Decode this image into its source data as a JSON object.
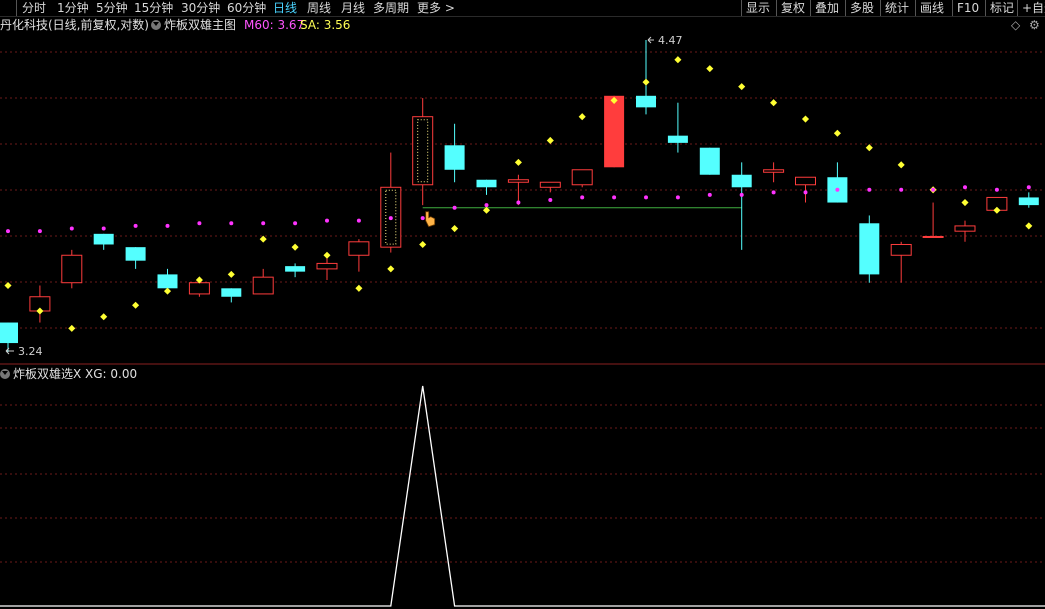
{
  "toolbar": {
    "left_tabs": [
      "分时",
      "1分钟",
      "5分钟",
      "15分钟",
      "30分钟",
      "60分钟",
      "日线",
      "周线",
      "月线",
      "多周期",
      "更多 >"
    ],
    "active_tab": "日线",
    "right_tabs": [
      "显示",
      "复权",
      "叠加",
      "多股",
      "统计",
      "画线",
      "F10",
      "标记",
      "+自选"
    ]
  },
  "main": {
    "stock_title": "丹化科技(日线,前复权,对数)",
    "indicator_name": "炸板双雄主图",
    "m60_label": "M60: 3.67",
    "sa_label": "SA: 3.56",
    "high_marker": "4.47",
    "low_marker": "3.24"
  },
  "sub": {
    "indicator_name": "炸板双雄选X",
    "xg_label": "XG: 0.00"
  },
  "colors": {
    "up": "#ff3d3d",
    "down": "#54ffff",
    "yellow_dots": "#ffff33",
    "magenta_dots": "#ff33ff",
    "grid": "#6b1a1a",
    "m60_text": "#ff55ff",
    "sa_text": "#ffff55",
    "active_tab": "#4ad4ff"
  },
  "chart_data": {
    "type": "candlestick",
    "candles": [
      {
        "o": 3.34,
        "c": 3.27,
        "h": 3.34,
        "l": 3.24
      },
      {
        "o": 3.38,
        "c": 3.43,
        "h": 3.47,
        "l": 3.34
      },
      {
        "o": 3.48,
        "c": 3.58,
        "h": 3.6,
        "l": 3.46
      },
      {
        "o": 3.66,
        "c": 3.62,
        "h": 3.66,
        "l": 3.6
      },
      {
        "o": 3.61,
        "c": 3.56,
        "h": 3.61,
        "l": 3.53
      },
      {
        "o": 3.51,
        "c": 3.46,
        "h": 3.53,
        "l": 3.45
      },
      {
        "o": 3.44,
        "c": 3.48,
        "h": 3.5,
        "l": 3.43
      },
      {
        "o": 3.46,
        "c": 3.43,
        "h": 3.46,
        "l": 3.41
      },
      {
        "o": 3.44,
        "c": 3.5,
        "h": 3.53,
        "l": 3.44
      },
      {
        "o": 3.54,
        "c": 3.52,
        "h": 3.55,
        "l": 3.5
      },
      {
        "o": 3.53,
        "c": 3.55,
        "h": 3.58,
        "l": 3.49
      },
      {
        "o": 3.58,
        "c": 3.63,
        "h": 3.64,
        "l": 3.52
      },
      {
        "o": 3.61,
        "c": 3.84,
        "h": 3.98,
        "l": 3.59
      },
      {
        "o": 3.85,
        "c": 4.13,
        "h": 4.21,
        "l": 3.77
      },
      {
        "o": 4.01,
        "c": 3.91,
        "h": 4.1,
        "l": 3.86
      },
      {
        "o": 3.87,
        "c": 3.84,
        "h": 3.87,
        "l": 3.81
      },
      {
        "o": 3.86,
        "c": 3.87,
        "h": 3.89,
        "l": 3.77
      },
      {
        "o": 3.84,
        "c": 3.86,
        "h": 3.86,
        "l": 3.82
      },
      {
        "o": 3.85,
        "c": 3.91,
        "h": 3.91,
        "l": 3.84
      },
      {
        "o": 3.92,
        "c": 4.22,
        "h": 4.22,
        "l": 3.92
      },
      {
        "o": 4.22,
        "c": 4.17,
        "h": 4.47,
        "l": 4.14
      },
      {
        "o": 4.05,
        "c": 4.02,
        "h": 4.19,
        "l": 3.98
      },
      {
        "o": 4.0,
        "c": 3.89,
        "h": 4.0,
        "l": 3.89
      },
      {
        "o": 3.89,
        "c": 3.84,
        "h": 3.94,
        "l": 3.6
      },
      {
        "o": 3.9,
        "c": 3.91,
        "h": 3.94,
        "l": 3.86
      },
      {
        "o": 3.85,
        "c": 3.88,
        "h": 3.88,
        "l": 3.78
      },
      {
        "o": 3.88,
        "c": 3.78,
        "h": 3.94,
        "l": 3.78
      },
      {
        "o": 3.7,
        "c": 3.51,
        "h": 3.73,
        "l": 3.48
      },
      {
        "o": 3.58,
        "c": 3.62,
        "h": 3.63,
        "l": 3.48
      },
      {
        "o": 3.65,
        "c": 3.65,
        "h": 3.78,
        "l": 3.65
      },
      {
        "o": 3.67,
        "c": 3.69,
        "h": 3.71,
        "l": 3.63
      },
      {
        "o": 3.75,
        "c": 3.8,
        "h": 3.8,
        "l": 3.75
      },
      {
        "o": 3.8,
        "c": 3.77,
        "h": 3.82,
        "l": 3.76
      }
    ],
    "yellow_dots": [
      3.47,
      3.38,
      3.32,
      3.36,
      3.4,
      3.45,
      3.49,
      3.51,
      3.64,
      3.61,
      3.58,
      3.46,
      3.53,
      3.62,
      3.68,
      3.75,
      3.94,
      4.03,
      4.13,
      4.2,
      4.28,
      4.38,
      4.34,
      4.26,
      4.19,
      4.12,
      4.06,
      4.0,
      3.93,
      3.83,
      3.78,
      3.75,
      3.69
    ],
    "magenta_dots": [
      3.67,
      3.67,
      3.68,
      3.68,
      3.69,
      3.69,
      3.7,
      3.7,
      3.7,
      3.7,
      3.71,
      3.71,
      3.72,
      3.72,
      3.76,
      3.77,
      3.78,
      3.79,
      3.8,
      3.8,
      3.8,
      3.8,
      3.81,
      3.81,
      3.82,
      3.82,
      3.83,
      3.83,
      3.83,
      3.83,
      3.84,
      3.83,
      3.84
    ],
    "support_line": {
      "from_index": 13,
      "to_index": 23,
      "value": 3.76
    },
    "xg_series": [
      0,
      0,
      0,
      0,
      0,
      0,
      0,
      0,
      0,
      0,
      0,
      0,
      0,
      1,
      0,
      0,
      0,
      0,
      0,
      0,
      0,
      0,
      0,
      0,
      0,
      0,
      0,
      0,
      0,
      0,
      0,
      0,
      0
    ]
  }
}
